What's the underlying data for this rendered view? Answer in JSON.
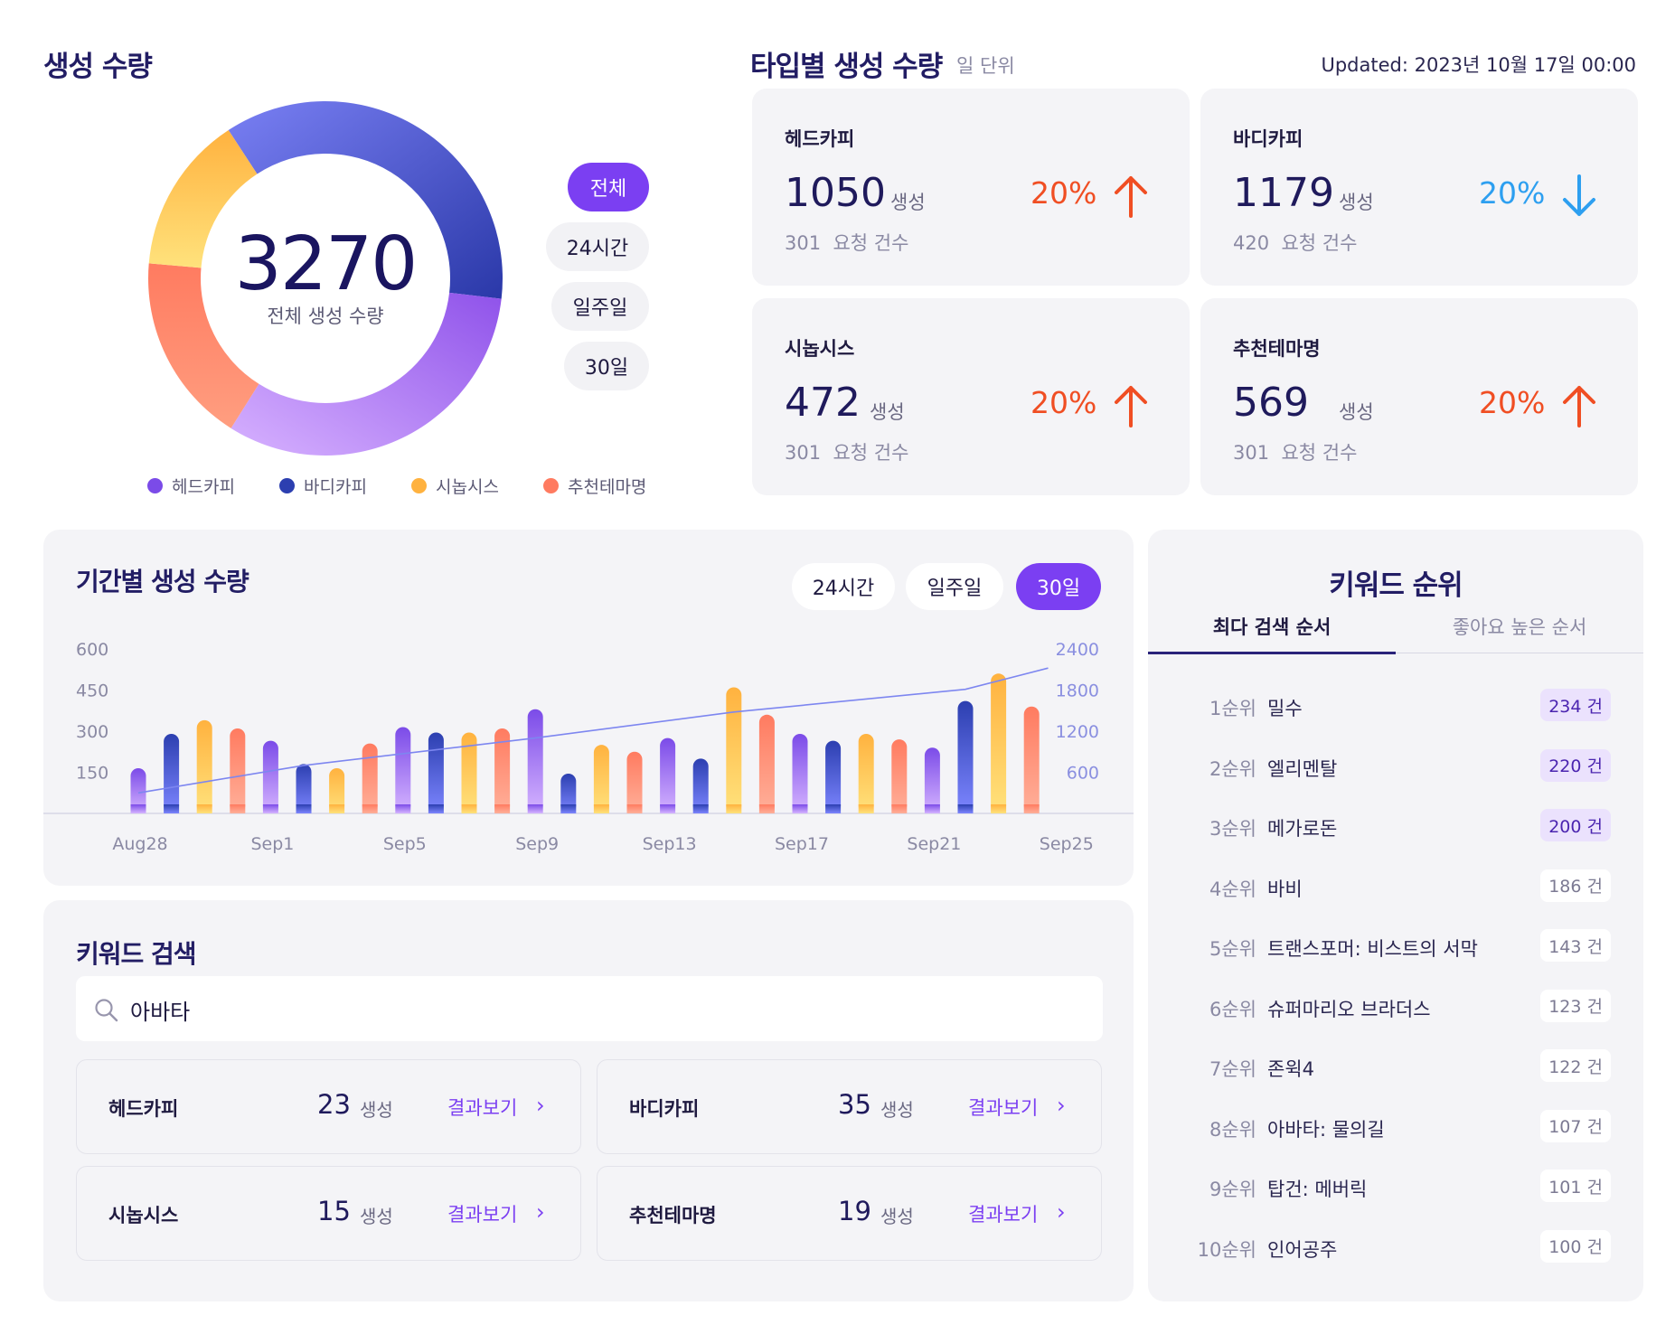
{
  "colors": {
    "accent": "#7b3ff2",
    "up": "#f04e23",
    "down": "#2d9ff0",
    "headcopy": "#7b4be8",
    "bodycopy": "#2c3fb0",
    "synopsis": "#ffb23f",
    "theme": "#ff7b60"
  },
  "donut": {
    "title": "생성 수량",
    "total": "3270",
    "total_label": "전체 생성 수량",
    "filters": [
      "전체",
      "24시간",
      "일주일",
      "30일"
    ],
    "active_filter": "전체",
    "legend": [
      "헤드카피",
      "바디카피",
      "시놉시스",
      "추천테마명"
    ],
    "chart_data": {
      "type": "pie",
      "categories": [
        "헤드카피",
        "바디카피",
        "시놉시스",
        "추천테마명"
      ],
      "values": [
        1050,
        1179,
        472,
        569
      ]
    }
  },
  "types": {
    "title": "타입별 생성 수량",
    "unit_note": "일 단위",
    "updated": "Updated: 2023년 10월 17일 00:00",
    "cards": [
      {
        "name": "헤드카피",
        "value": "1050",
        "unit": "생성",
        "pct": "20%",
        "trend": "up",
        "requests": "301",
        "requests_label": "요청 건수"
      },
      {
        "name": "바디카피",
        "value": "1179",
        "unit": "생성",
        "pct": "20%",
        "trend": "down",
        "requests": "420",
        "requests_label": "요청 건수"
      },
      {
        "name": "시놉시스",
        "value": "472",
        "unit": "생성",
        "pct": "20%",
        "trend": "up",
        "requests": "301",
        "requests_label": "요청 건수"
      },
      {
        "name": "추천테마명",
        "value": "569",
        "unit": "생성",
        "pct": "20%",
        "trend": "up",
        "requests": "301",
        "requests_label": "요청 건수"
      }
    ]
  },
  "period": {
    "title": "기간별 생성 수량",
    "filters": [
      "24시간",
      "일주일",
      "30일"
    ],
    "active_filter": "30일",
    "chart_data": {
      "type": "bar",
      "left_ticks": [
        "600",
        "450",
        "300",
        "150"
      ],
      "right_ticks": [
        "2400",
        "1800",
        "1200",
        "600"
      ],
      "ylim_left": [
        0,
        600
      ],
      "ylim_right": [
        0,
        2400
      ],
      "x_labels": [
        "Aug28",
        "Sep1",
        "Sep5",
        "Sep9",
        "Sep13",
        "Sep17",
        "Sep21",
        "Sep25"
      ],
      "bars": [
        {
          "value": 165,
          "color": "purple"
        },
        {
          "value": 290,
          "color": "blue"
        },
        {
          "value": 340,
          "color": "yellow"
        },
        {
          "value": 310,
          "color": "orange"
        },
        {
          "value": 265,
          "color": "purple"
        },
        {
          "value": 180,
          "color": "blue"
        },
        {
          "value": 165,
          "color": "yellow"
        },
        {
          "value": 255,
          "color": "orange"
        },
        {
          "value": 315,
          "color": "purple"
        },
        {
          "value": 295,
          "color": "blue"
        },
        {
          "value": 295,
          "color": "yellow"
        },
        {
          "value": 310,
          "color": "orange"
        },
        {
          "value": 380,
          "color": "purple"
        },
        {
          "value": 145,
          "color": "blue"
        },
        {
          "value": 250,
          "color": "yellow"
        },
        {
          "value": 225,
          "color": "orange"
        },
        {
          "value": 275,
          "color": "purple"
        },
        {
          "value": 200,
          "color": "blue"
        },
        {
          "value": 460,
          "color": "yellow"
        },
        {
          "value": 360,
          "color": "orange"
        },
        {
          "value": 290,
          "color": "purple"
        },
        {
          "value": 265,
          "color": "blue"
        },
        {
          "value": 290,
          "color": "yellow"
        },
        {
          "value": 270,
          "color": "orange"
        },
        {
          "value": 240,
          "color": "purple"
        },
        {
          "value": 410,
          "color": "blue"
        },
        {
          "value": 510,
          "color": "yellow"
        },
        {
          "value": 390,
          "color": "orange"
        }
      ],
      "line": [
        {
          "i": 0,
          "value": 300
        },
        {
          "i": 5,
          "value": 700
        },
        {
          "i": 12,
          "value": 1100
        },
        {
          "i": 18,
          "value": 1480
        },
        {
          "i": 25,
          "value": 1810
        },
        {
          "i": 27.5,
          "value": 2120
        }
      ]
    }
  },
  "search": {
    "title": "키워드 검색",
    "query": "아바타",
    "results": [
      {
        "name": "헤드카피",
        "count": "23",
        "unit": "생성",
        "link": "결과보기"
      },
      {
        "name": "바디카피",
        "count": "35",
        "unit": "생성",
        "link": "결과보기"
      },
      {
        "name": "시놉시스",
        "count": "15",
        "unit": "생성",
        "link": "결과보기"
      },
      {
        "name": "추천테마명",
        "count": "19",
        "unit": "생성",
        "link": "결과보기"
      }
    ]
  },
  "ranking": {
    "title": "키워드 순위",
    "tabs": [
      "최다 검색 순서",
      "좋아요 높은 순서"
    ],
    "active_tab": "최다 검색 순서",
    "items": [
      {
        "rank": "1순위",
        "keyword": "밀수",
        "count": "234 건"
      },
      {
        "rank": "2순위",
        "keyword": "엘리멘탈",
        "count": "220 건"
      },
      {
        "rank": "3순위",
        "keyword": "메가로돈",
        "count": "200 건"
      },
      {
        "rank": "4순위",
        "keyword": "바비",
        "count": "186 건"
      },
      {
        "rank": "5순위",
        "keyword": "트랜스포머: 비스트의 서막",
        "count": "143 건"
      },
      {
        "rank": "6순위",
        "keyword": "슈퍼마리오 브라더스",
        "count": "123 건"
      },
      {
        "rank": "7순위",
        "keyword": "존윅4",
        "count": "122 건"
      },
      {
        "rank": "8순위",
        "keyword": "아바타: 물의길",
        "count": "107 건"
      },
      {
        "rank": "9순위",
        "keyword": "탑건: 메버릭",
        "count": "101 건"
      },
      {
        "rank": "10순위",
        "keyword": "인어공주",
        "count": "100 건"
      }
    ]
  }
}
